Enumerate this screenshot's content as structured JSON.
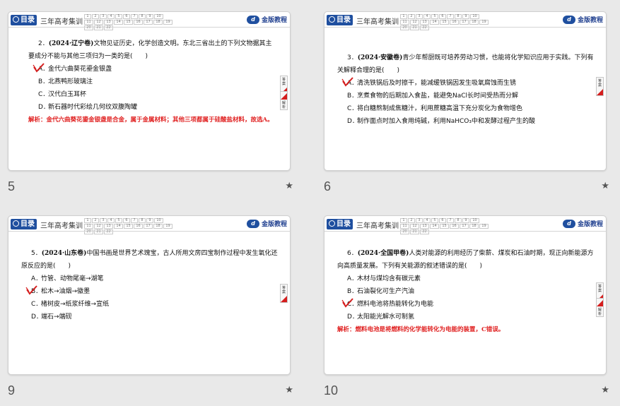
{
  "header": {
    "logo_label": "目录",
    "series_label": "三年高考集训",
    "question_numbers": [
      "1",
      "2",
      "3",
      "4",
      "5",
      "6",
      "7",
      "8",
      "9",
      "10",
      "11",
      "12",
      "13",
      "14",
      "15",
      "16",
      "17",
      "18",
      "19",
      "20",
      "21",
      "22"
    ],
    "brand_label": "金版教程",
    "brand_mark": "d"
  },
  "side_tabs": {
    "answer": "答案",
    "analysis": "解析"
  },
  "slides": [
    {
      "number": "5",
      "question": {
        "number": "2．",
        "source": "(2024·辽宁卷)",
        "stem": "文物见证历史，化学创造文明。东北三省出土的下列文物据其主要成分不能与其他三项归为一类的是(　　)",
        "options": [
          {
            "letter": "A．",
            "text": "金代六曲葵花鎏金银盏"
          },
          {
            "letter": "B．",
            "text": "北燕鸭形玻璃注"
          },
          {
            "letter": "C．",
            "text": "汉代白玉耳杯"
          },
          {
            "letter": "D．",
            "text": "新石器时代彩绘几何纹双腹陶罐"
          }
        ],
        "analysis": "解析：金代六曲葵花鎏金银盏是合金，属于金属材料；其他三项都属于硅酸盐材料，故选A。"
      }
    },
    {
      "number": "6",
      "question": {
        "number": "3．",
        "source": "(2024·安徽卷)",
        "stem": "青少年帮厨既可培养劳动习惯，也能将化学知识应用于实践。下列有关解释合理的是(　　)",
        "options": [
          {
            "letter": "A．",
            "text": "清洗铁锅后及时擦干，能减缓铁锅因发生吸氧腐蚀而生锈"
          },
          {
            "letter": "B．",
            "text": "烹煮食物的后期加入食盐，能避免NaCl长时间受热而分解"
          },
          {
            "letter": "C．",
            "text": "将白糖熬制成焦糖汁，利用蔗糖高温下充分炭化为食物增色"
          },
          {
            "letter": "D．",
            "text": "制作面点时加入食用纯碱，利用NaHCO₃中和发酵过程产生的酸"
          }
        ],
        "analysis": ""
      }
    },
    {
      "number": "9",
      "question": {
        "number": "5．",
        "source": "(2024·山东卷)",
        "stem": "中国书画是世界艺术瑰宝，古人所用文房四宝制作过程中发生氧化还原反应的是(　　)",
        "options": [
          {
            "letter": "A．",
            "text": "竹管、动物尾毫→湖笔"
          },
          {
            "letter": "B．",
            "text": "松木→油烟→徽墨"
          },
          {
            "letter": "C．",
            "text": "楮树皮→纸浆纤维→宣纸"
          },
          {
            "letter": "D．",
            "text": "端石→端砚"
          }
        ],
        "analysis": ""
      }
    },
    {
      "number": "10",
      "question": {
        "number": "6．",
        "source": "(2024·全国甲卷)",
        "stem": "人类对能源的利用经历了柴薪、煤炭和石油时期，现正向新能源方向高质量发展。下列有关能源的叙述错误的是(　　)",
        "options": [
          {
            "letter": "A．",
            "text": "木材与煤均含有碳元素"
          },
          {
            "letter": "B．",
            "text": "石油裂化可生产汽油"
          },
          {
            "letter": "C．",
            "text": "燃料电池将热能转化为电能"
          },
          {
            "letter": "D．",
            "text": "太阳能光解水可制氢"
          }
        ],
        "analysis": "解析：燃料电池是将燃料的化学能转化为电能的装置，C错误。"
      }
    }
  ],
  "star_icon": "★"
}
